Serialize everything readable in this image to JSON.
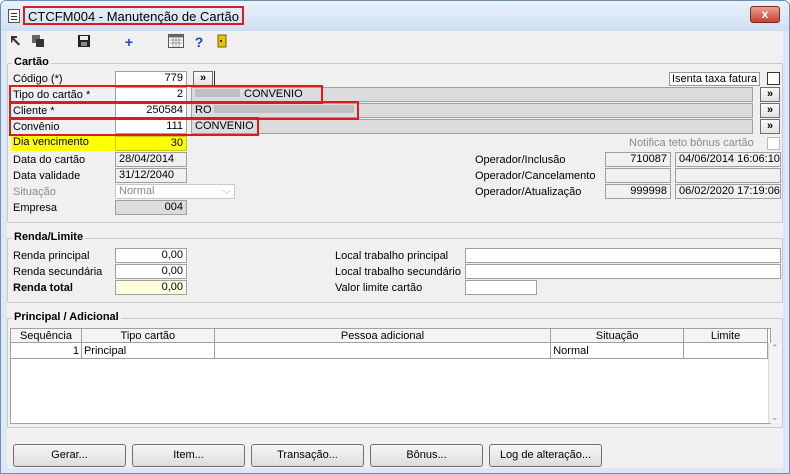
{
  "window": {
    "title": "CTCFM004 - Manutenção de Cartão",
    "close_label": "x"
  },
  "toolbar": {
    "add_label": "+",
    "help_label": "?"
  },
  "cartao": {
    "group_title": "Cartão",
    "codigo_label": "Código (*)",
    "codigo_value": "779",
    "tipo_label": "Tipo do cartão *",
    "tipo_value": "2",
    "tipo_desc": "CONVENIO",
    "cliente_label": "Cliente *",
    "cliente_value": "250584",
    "cliente_desc": "RO",
    "convenio_label": "Convênio",
    "convenio_value": "111",
    "convenio_desc": "CONVENIO",
    "dia_label": "Dia vencimento",
    "dia_value": "30",
    "data_cartao_label": "Data do cartão",
    "data_cartao_value": "28/04/2014",
    "data_validade_label": "Data validade",
    "data_validade_value": "31/12/2040",
    "situacao_label": "Situação",
    "situacao_value": "Normal",
    "empresa_label": "Empresa",
    "empresa_value": "004",
    "more_label": "»",
    "isenta_label": "Isenta taxa fatura",
    "notifica_label": "Notifica teto bônus cartão",
    "op_inclusao_label": "Operador/Inclusão",
    "op_inclusao_value": "710087",
    "op_inclusao_date": "04/06/2014 16:06:10",
    "op_cancelamento_label": "Operador/Cancelamento",
    "op_cancelamento_value": "",
    "op_cancelamento_date": "",
    "op_atualizacao_label": "Operador/Atualização",
    "op_atualizacao_value": "999998",
    "op_atualizacao_date": "06/02/2020 17:19:06"
  },
  "renda": {
    "group_title": "Renda/Limite",
    "principal_label": "Renda principal",
    "principal_value": "0,00",
    "secundaria_label": "Renda secundária",
    "secundaria_value": "0,00",
    "total_label": "Renda total",
    "total_value": "0,00",
    "local_principal_label": "Local trabalho principal",
    "local_principal_value": "",
    "local_secundario_label": "Local trabalho secundário",
    "local_secundario_value": "",
    "valor_limite_label": "Valor limite cartão",
    "valor_limite_value": ""
  },
  "adicional": {
    "group_title": "Principal / Adicional",
    "columns": [
      "Sequência",
      "Tipo cartão",
      "Pessoa adicional",
      "Situação",
      "Limite"
    ],
    "rows": [
      {
        "sequencia": "1",
        "tipo": "Principal",
        "pessoa": "",
        "situacao": "Normal",
        "limite": ""
      }
    ]
  },
  "buttons": {
    "gerar": "Gerar...",
    "item": "Item...",
    "transacao": "Transação...",
    "bonus": "Bônus...",
    "log": "Log de alteração..."
  },
  "colors": {
    "highlight_yellow": "#ffff00",
    "annotation_red": "#e0191e"
  }
}
